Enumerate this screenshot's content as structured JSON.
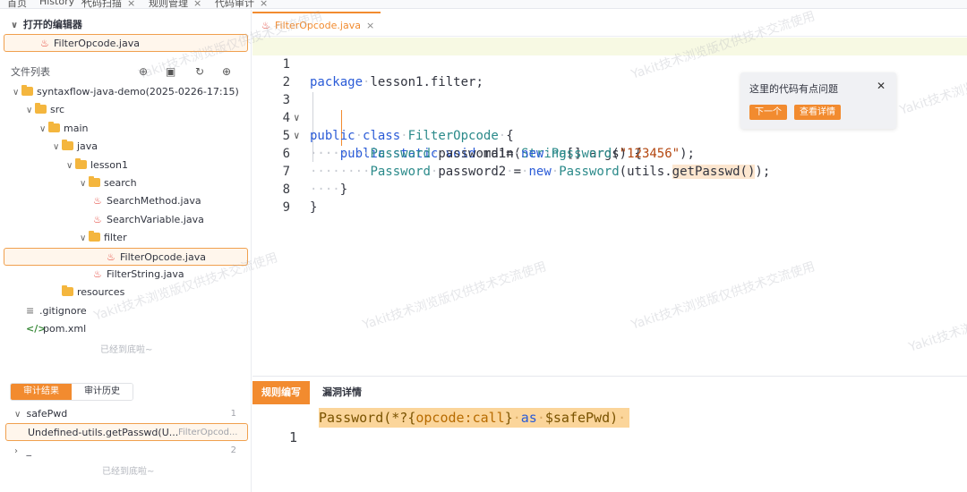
{
  "top_tabs": [
    {
      "label": "首页",
      "closable": false
    },
    {
      "label": "History",
      "closable": true
    },
    {
      "label": "代码扫描",
      "closable": true
    },
    {
      "label": "规则管理",
      "closable": true
    },
    {
      "label": "代码审计",
      "closable": true
    }
  ],
  "sidebar": {
    "open_editors_title": "打开的编辑器",
    "open_editor_file": "FilterOpcode.java",
    "file_list_title": "文件列表",
    "tree": [
      {
        "label": "syntaxflow-java-demo(2025-0226-17:15)",
        "type": "folder",
        "depth": 0,
        "expanded": true
      },
      {
        "label": "src",
        "type": "folder",
        "depth": 1,
        "expanded": true
      },
      {
        "label": "main",
        "type": "folder",
        "depth": 2,
        "expanded": true
      },
      {
        "label": "java",
        "type": "folder",
        "depth": 3,
        "expanded": true
      },
      {
        "label": "lesson1",
        "type": "folder",
        "depth": 4,
        "expanded": true
      },
      {
        "label": "search",
        "type": "folder",
        "depth": 5,
        "expanded": true
      },
      {
        "label": "SearchMethod.java",
        "type": "java",
        "depth": 6
      },
      {
        "label": "SearchVariable.java",
        "type": "java",
        "depth": 6
      },
      {
        "label": "filter",
        "type": "folder",
        "depth": 5,
        "expanded": true
      },
      {
        "label": "FilterOpcode.java",
        "type": "java",
        "depth": 6,
        "selected": true
      },
      {
        "label": "FilterString.java",
        "type": "java",
        "depth": 6
      },
      {
        "label": "resources",
        "type": "folder",
        "depth": 3
      },
      {
        "label": ".gitignore",
        "type": "text",
        "depth": 1
      },
      {
        "label": "pom.xml",
        "type": "xml",
        "depth": 1
      }
    ],
    "tree_end": "已经到底啦~",
    "result_tabs": [
      "审计结果",
      "审计历史"
    ],
    "results": [
      {
        "label": "safePwd",
        "count": "1",
        "expanded": true
      },
      {
        "label": "Undefined-utils.getPasswd(U...",
        "file": "FilterOpcod...",
        "selected": true
      },
      {
        "label": "_",
        "count": "2",
        "expanded": false
      }
    ],
    "results_end": "已经到底啦~"
  },
  "editor": {
    "tab_label": "FilterOpcode.java",
    "lines": [
      {
        "num": "1",
        "text": "package lesson1.filter;"
      },
      {
        "num": "2",
        "text": ""
      },
      {
        "num": "3",
        "text": "public class FilterOpcode {"
      },
      {
        "num": "4",
        "text": "    public static void main(String[] args) {"
      },
      {
        "num": "5",
        "text": "        Password password1= new Password(\"123456\");"
      },
      {
        "num": "6",
        "text": "        Password password2 = new Password(utils.getPasswd());"
      },
      {
        "num": "7",
        "text": "    }"
      },
      {
        "num": "8",
        "text": "}"
      },
      {
        "num": "9",
        "text": ""
      }
    ],
    "tooltip": {
      "message": "这里的代码有点问题",
      "next_label": "下一个",
      "detail_label": "查看详情"
    }
  },
  "rules_panel": {
    "tabs": [
      "规则编写",
      "漏洞详情"
    ],
    "line_num": "1",
    "rule_text": "Password(*?{opcode:call} as $safePwd)"
  },
  "watermark": "Yakit技术浏览版仅供技术交流使用",
  "colors": {
    "accent": "#f28b2f",
    "keyword": "#2a5bd7",
    "type": "#2b8a8a",
    "string": "#b3460f"
  }
}
